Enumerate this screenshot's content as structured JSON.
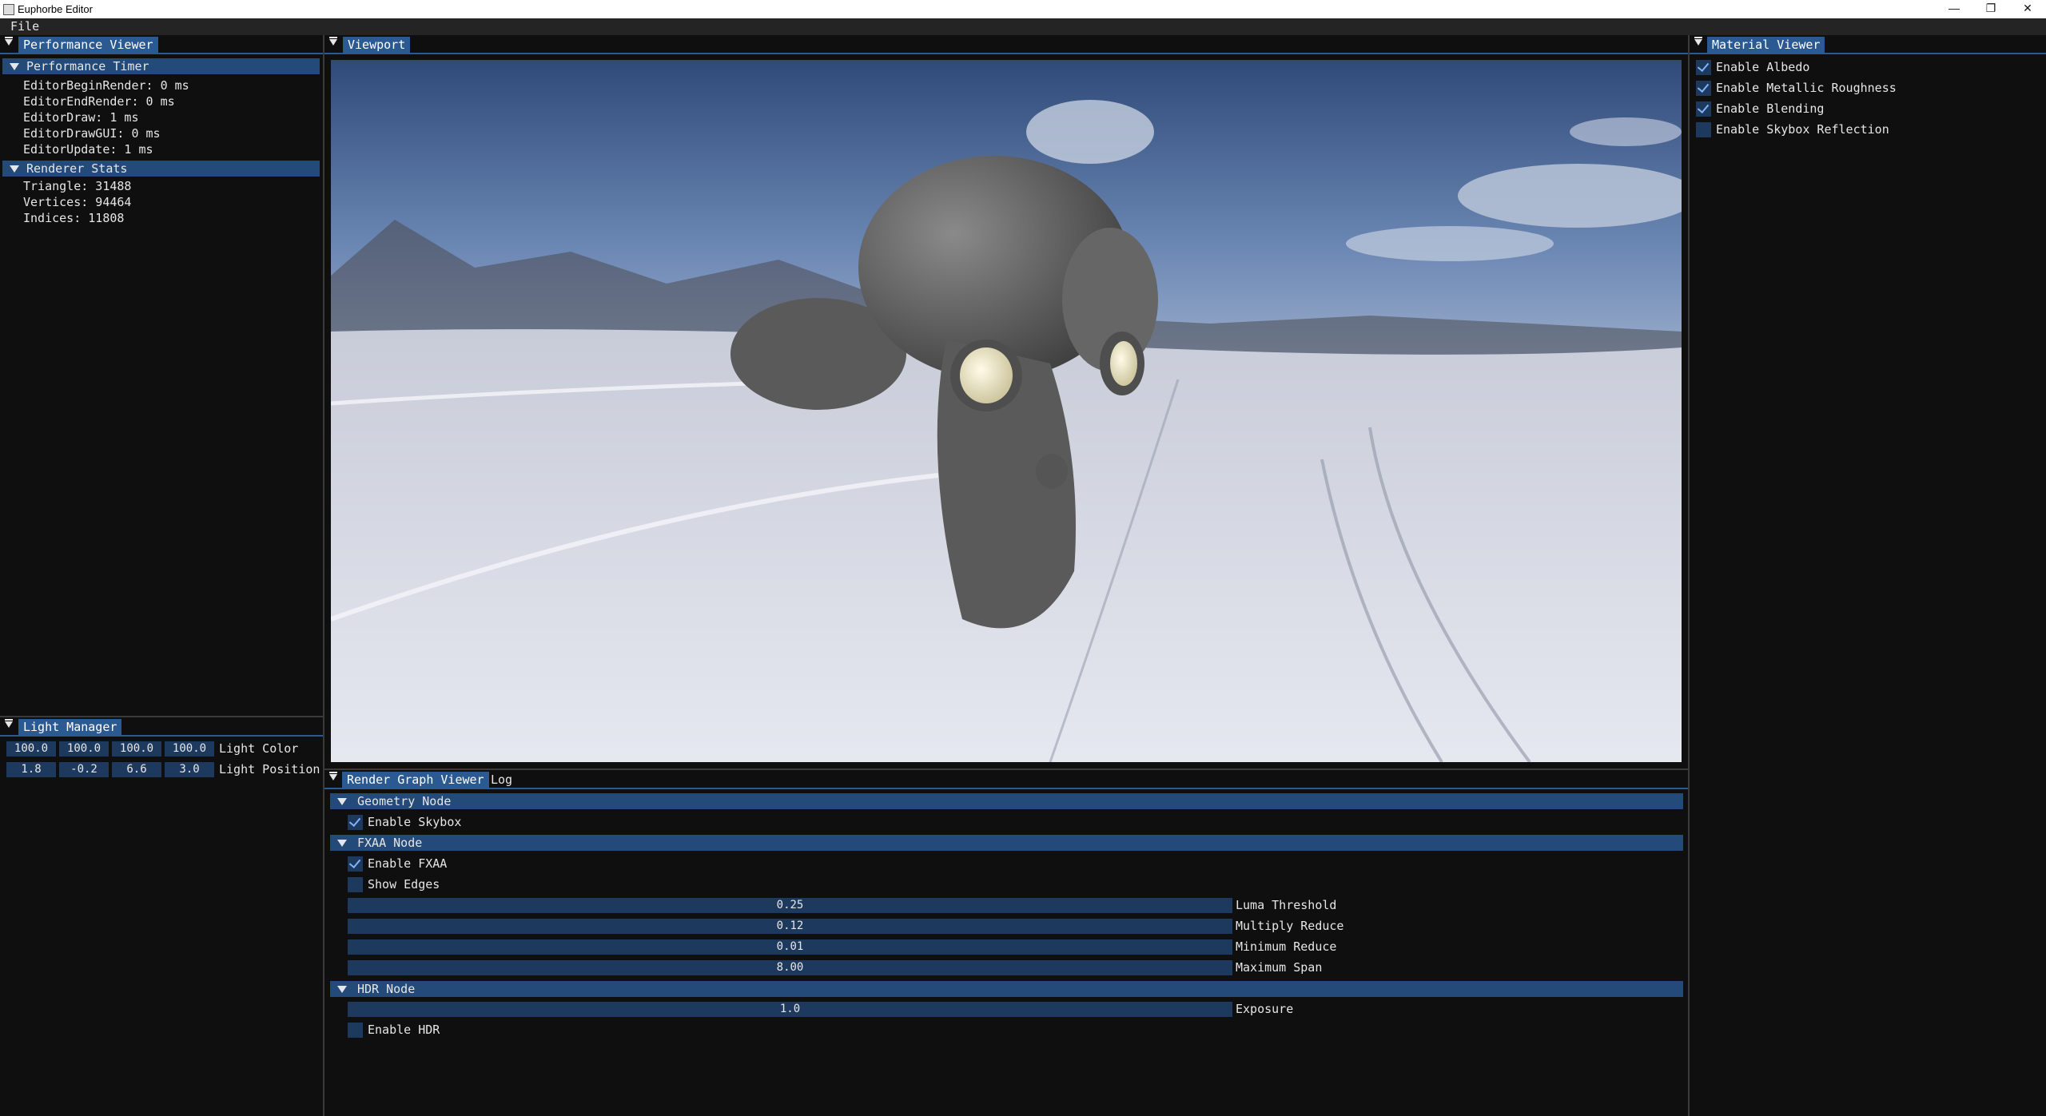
{
  "window": {
    "title": "Euphorbe Editor",
    "minimize": "—",
    "maximize": "❐",
    "close": "✕"
  },
  "menu": {
    "file": "File"
  },
  "performance_viewer": {
    "tab": "Performance Viewer",
    "timer_header": "Performance Timer",
    "timers": [
      "EditorBeginRender: 0 ms",
      "EditorEndRender: 0 ms",
      "EditorDraw: 1 ms",
      "EditorDrawGUI: 0 ms",
      "EditorUpdate: 1 ms"
    ],
    "stats_header": "Renderer Stats",
    "stats": [
      "Triangle: 31488",
      "Vertices: 94464",
      "Indices: 11808"
    ]
  },
  "light_manager": {
    "tab": "Light Manager",
    "color_values": [
      "100.0",
      "100.0",
      "100.0",
      "100.0"
    ],
    "color_label": "Light Color",
    "position_values": [
      "1.8",
      "-0.2",
      "6.6",
      "3.0"
    ],
    "position_label": "Light Position"
  },
  "viewport": {
    "tab": "Viewport"
  },
  "material_viewer": {
    "tab": "Material Viewer",
    "options": [
      {
        "label": "Enable Albedo",
        "checked": true
      },
      {
        "label": "Enable Metallic Roughness",
        "checked": true
      },
      {
        "label": "Enable Blending",
        "checked": true
      },
      {
        "label": "Enable Skybox Reflection",
        "checked": false
      }
    ]
  },
  "render_graph": {
    "tab_active": "Render Graph Viewer",
    "tab_log": "Log",
    "geometry_header": "Geometry Node",
    "enable_skybox": {
      "label": "Enable Skybox",
      "checked": true
    },
    "fxaa_header": "FXAA Node",
    "enable_fxaa": {
      "label": "Enable FXAA",
      "checked": true
    },
    "show_edges": {
      "label": "Show Edges",
      "checked": false
    },
    "fxaa_params": [
      {
        "value": "0.25",
        "label": "Luma Threshold"
      },
      {
        "value": "0.12",
        "label": "Multiply Reduce"
      },
      {
        "value": "0.01",
        "label": "Minimum Reduce"
      },
      {
        "value": "8.00",
        "label": "Maximum Span"
      }
    ],
    "hdr_header": "HDR Node",
    "exposure": {
      "value": "1.0",
      "label": "Exposure"
    },
    "enable_hdr": {
      "label": "Enable HDR",
      "checked": false
    }
  }
}
